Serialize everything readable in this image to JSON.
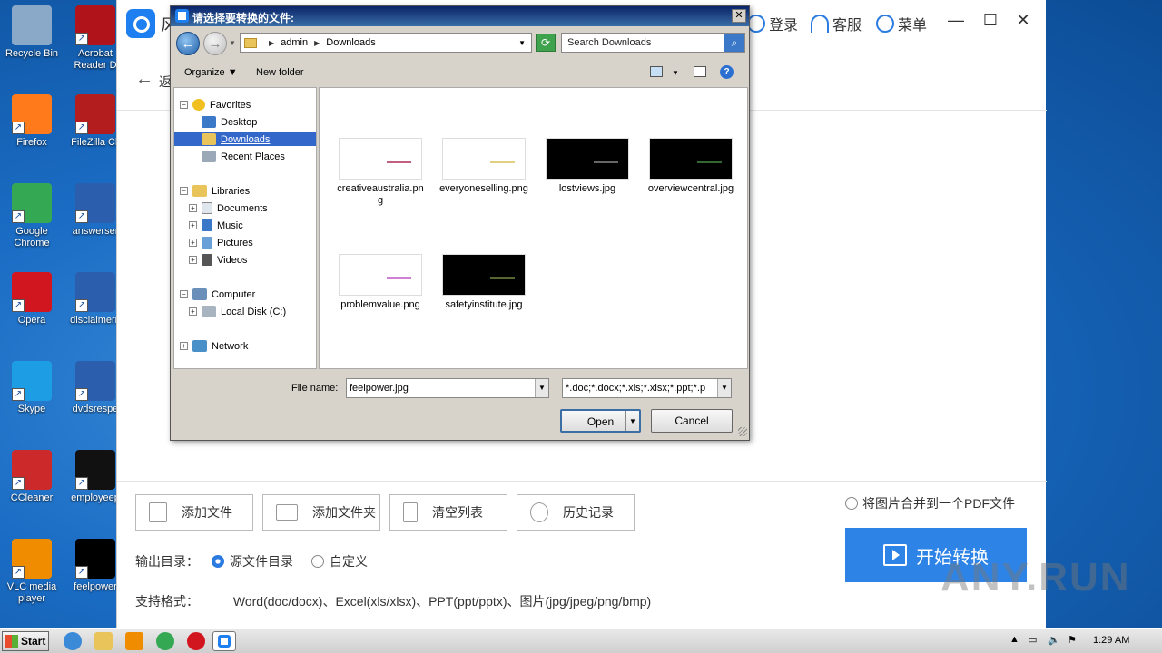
{
  "desktop": {
    "icons": [
      {
        "label": "Recycle Bin",
        "color": "#8aa8c8"
      },
      {
        "label": "Acrobat Reader D",
        "color": "#b0131a"
      },
      {
        "label": "Firefox",
        "color": "#ff7a1a"
      },
      {
        "label": "FileZilla Cli",
        "color": "#b31d1d"
      },
      {
        "label": "Google Chrome",
        "color": "#34a853"
      },
      {
        "label": "answerser",
        "color": "#2b5fad"
      },
      {
        "label": "Opera",
        "color": "#d2161f"
      },
      {
        "label": "disclaimern",
        "color": "#2b5fad"
      },
      {
        "label": "Skype",
        "color": "#1d9de3"
      },
      {
        "label": "dvdsrespe",
        "color": "#2b5fad"
      },
      {
        "label": "CCleaner",
        "color": "#cc2a2a"
      },
      {
        "label": "employeep",
        "color": "#111111"
      },
      {
        "label": "VLC media player",
        "color": "#f08c00"
      },
      {
        "label": "feelpower",
        "color": "#000000"
      }
    ]
  },
  "app": {
    "title": "风",
    "login": "登录",
    "service": "客服",
    "menu": "菜单",
    "back_label": "返",
    "buttons": {
      "add_file": "添加文件",
      "add_folder": "添加文件夹",
      "clear_list": "清空列表",
      "history": "历史记录"
    },
    "merge_option": "将图片合并到一个PDF文件",
    "output_dir_label": "输出目录：",
    "output_source": "源文件目录",
    "output_custom": "自定义",
    "formats_label": "支持格式：",
    "formats_value": "Word(doc/docx)、Excel(xls/xlsx)、PPT(ppt/pptx)、图片(jpg/jpeg/png/bmp)",
    "start_button": "开始转换",
    "accent_color": "#2d83e6"
  },
  "watermark": "ANY.RUN",
  "dialog": {
    "title": "请选择要转换的文件:",
    "breadcrumb": [
      "admin",
      "Downloads"
    ],
    "search_placeholder": "Search Downloads",
    "organize": "Organize",
    "new_folder": "New folder",
    "tree": {
      "favorites": "Favorites",
      "desktop": "Desktop",
      "downloads": "Downloads",
      "recent": "Recent Places",
      "libraries": "Libraries",
      "documents": "Documents",
      "music": "Music",
      "pictures": "Pictures",
      "videos": "Videos",
      "computer": "Computer",
      "local_disk": "Local Disk (C:)",
      "network": "Network"
    },
    "files": [
      {
        "name": "creativeaustralia.png",
        "bg": "#ffffff",
        "mark": "#c06080"
      },
      {
        "name": "everyoneselling.png",
        "bg": "#ffffff",
        "mark": "#e0d080"
      },
      {
        "name": "lostviews.jpg",
        "bg": "#000000",
        "mark": "#666666"
      },
      {
        "name": "overviewcentral.jpg",
        "bg": "#000000",
        "mark": "#336633"
      },
      {
        "name": "problemvalue.png",
        "bg": "#ffffff",
        "mark": "#d080d0"
      },
      {
        "name": "safetyinstitute.jpg",
        "bg": "#000000",
        "mark": "#556633"
      }
    ],
    "file_name_label": "File name:",
    "file_name_value": "feelpower.jpg",
    "file_type_value": "*.doc;*.docx;*.xls;*.xlsx;*.ppt;*.p",
    "open_button": "Open",
    "cancel_button": "Cancel"
  },
  "taskbar": {
    "start": "Start",
    "clock": "1:29 AM"
  }
}
